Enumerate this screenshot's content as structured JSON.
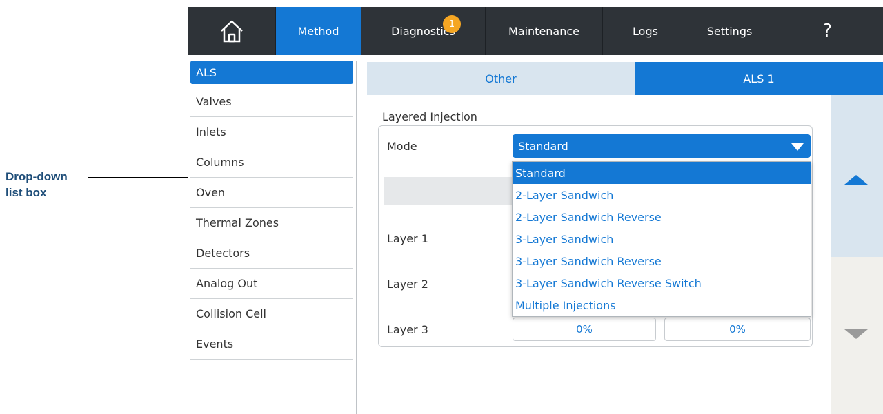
{
  "callout": {
    "line1": "Drop-down",
    "line2": "list box"
  },
  "topbar": {
    "home_icon": "home-icon",
    "tabs": [
      "Method",
      "Diagnostics",
      "Maintenance",
      "Logs",
      "Settings",
      "?"
    ],
    "diagnostics_badge": "1",
    "active_tab": "Method"
  },
  "sidebar": {
    "items": [
      "ALS",
      "Valves",
      "Inlets",
      "Columns",
      "Oven",
      "Thermal Zones",
      "Detectors",
      "Analog Out",
      "Collision Cell",
      "Events"
    ],
    "active": "ALS"
  },
  "subtabs": [
    "Other",
    "ALS 1"
  ],
  "section": {
    "title": "Layered Injection",
    "mode_label": "Mode",
    "mode_value": "Standard",
    "layer_labels": [
      "Layer 1",
      "Layer 2",
      "Layer 3"
    ],
    "layer3_values": [
      "0%",
      "0%"
    ]
  },
  "dropdown": {
    "options": [
      "Standard",
      "2-Layer Sandwich",
      "2-Layer Sandwich Reverse",
      "3-Layer Sandwich",
      "3-Layer Sandwich Reverse",
      "3-Layer Sandwich Reverse Switch",
      "Multiple Injections"
    ],
    "selected": "Standard"
  },
  "colors": {
    "accent": "#1478d4",
    "topbar": "#2e3338",
    "badge": "#f5a623",
    "callout_text": "#1f4e79"
  }
}
